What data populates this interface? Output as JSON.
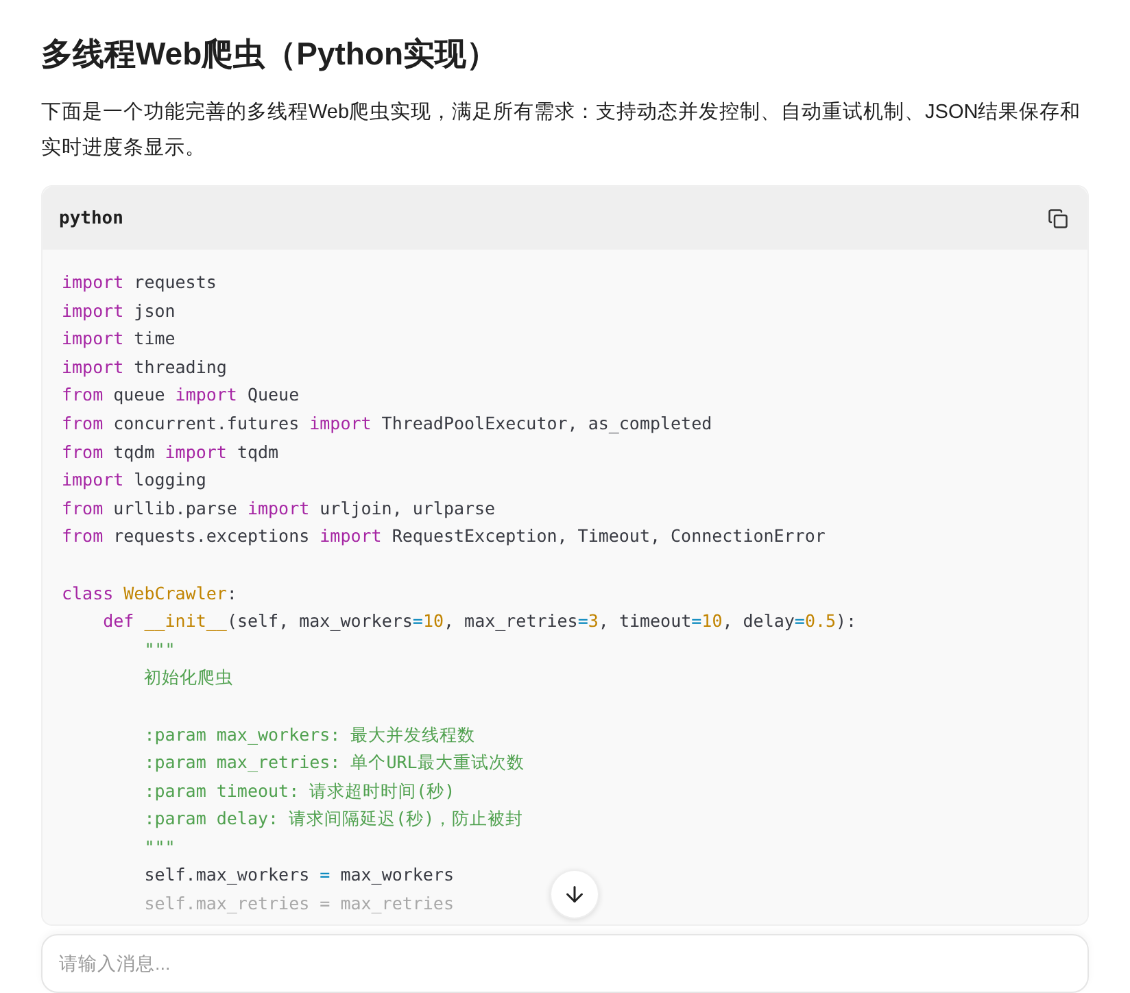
{
  "title": "多线程Web爬虫（Python实现）",
  "intro": "下面是一个功能完善的多线程Web爬虫实现，满足所有需求：支持动态并发控制、自动重试机制、JSON结果保存和实时进度条显示。",
  "code_block": {
    "language": "python",
    "sections": [
      [
        [
          {
            "kind": "keyword",
            "text": "import"
          },
          {
            "kind": "plain",
            "text": " requests"
          }
        ],
        [
          {
            "kind": "keyword",
            "text": "import"
          },
          {
            "kind": "plain",
            "text": " json"
          }
        ],
        [
          {
            "kind": "keyword",
            "text": "import"
          },
          {
            "kind": "plain",
            "text": " time"
          }
        ],
        [
          {
            "kind": "keyword",
            "text": "import"
          },
          {
            "kind": "plain",
            "text": " threading"
          }
        ],
        [
          {
            "kind": "keyword",
            "text": "from"
          },
          {
            "kind": "plain",
            "text": " queue "
          },
          {
            "kind": "keyword",
            "text": "import"
          },
          {
            "kind": "plain",
            "text": " Queue"
          }
        ],
        [
          {
            "kind": "keyword",
            "text": "from"
          },
          {
            "kind": "plain",
            "text": " concurrent.futures "
          },
          {
            "kind": "keyword",
            "text": "import"
          },
          {
            "kind": "plain",
            "text": " ThreadPoolExecutor, as_completed"
          }
        ],
        [
          {
            "kind": "keyword",
            "text": "from"
          },
          {
            "kind": "plain",
            "text": " tqdm "
          },
          {
            "kind": "keyword",
            "text": "import"
          },
          {
            "kind": "plain",
            "text": " tqdm"
          }
        ],
        [
          {
            "kind": "keyword",
            "text": "import"
          },
          {
            "kind": "plain",
            "text": " logging"
          }
        ],
        [
          {
            "kind": "keyword",
            "text": "from"
          },
          {
            "kind": "plain",
            "text": " urllib.parse "
          },
          {
            "kind": "keyword",
            "text": "import"
          },
          {
            "kind": "plain",
            "text": " urljoin, urlparse"
          }
        ],
        [
          {
            "kind": "keyword",
            "text": "from"
          },
          {
            "kind": "plain",
            "text": " requests.exceptions "
          },
          {
            "kind": "keyword",
            "text": "import"
          },
          {
            "kind": "plain",
            "text": " RequestException, Timeout, ConnectionError"
          }
        ]
      ],
      [
        [
          {
            "kind": "keyword",
            "text": "class "
          },
          {
            "kind": "class",
            "text": "WebCrawler"
          },
          {
            "kind": "plain",
            "text": ":"
          }
        ],
        [
          {
            "kind": "keyword",
            "text": "    def "
          },
          {
            "kind": "class",
            "text": "__init__"
          },
          {
            "kind": "plain",
            "text": "(self, max_workers"
          },
          {
            "kind": "operator",
            "text": "="
          },
          {
            "kind": "number",
            "text": "10"
          },
          {
            "kind": "plain",
            "text": ", max_retries"
          },
          {
            "kind": "operator",
            "text": "="
          },
          {
            "kind": "number",
            "text": "3"
          },
          {
            "kind": "plain",
            "text": ", timeout"
          },
          {
            "kind": "operator",
            "text": "="
          },
          {
            "kind": "number",
            "text": "10"
          },
          {
            "kind": "plain",
            "text": ", delay"
          },
          {
            "kind": "operator",
            "text": "="
          },
          {
            "kind": "number",
            "text": "0.5"
          },
          {
            "kind": "plain",
            "text": "):"
          }
        ],
        [
          {
            "kind": "string",
            "text": "        \"\"\""
          }
        ],
        [
          {
            "kind": "string",
            "text": "        初始化爬虫"
          }
        ]
      ],
      [
        [
          {
            "kind": "string",
            "text": "        :param max_workers: 最大并发线程数"
          }
        ],
        [
          {
            "kind": "string",
            "text": "        :param max_retries: 单个URL最大重试次数"
          }
        ],
        [
          {
            "kind": "string",
            "text": "        :param timeout: 请求超时时间(秒)"
          }
        ],
        [
          {
            "kind": "string",
            "text": "        :param delay: 请求间隔延迟(秒)，防止被封"
          }
        ],
        [
          {
            "kind": "string",
            "text": "        \"\"\""
          }
        ],
        [
          {
            "kind": "plain",
            "text": "        self.max_workers "
          },
          {
            "kind": "operator",
            "text": "="
          },
          {
            "kind": "plain",
            "text": " max_workers"
          }
        ],
        [
          {
            "kind": "faded",
            "text": "        self.max_retries = max_retries"
          }
        ]
      ]
    ]
  },
  "message_input": {
    "placeholder": "请输入消息..."
  }
}
